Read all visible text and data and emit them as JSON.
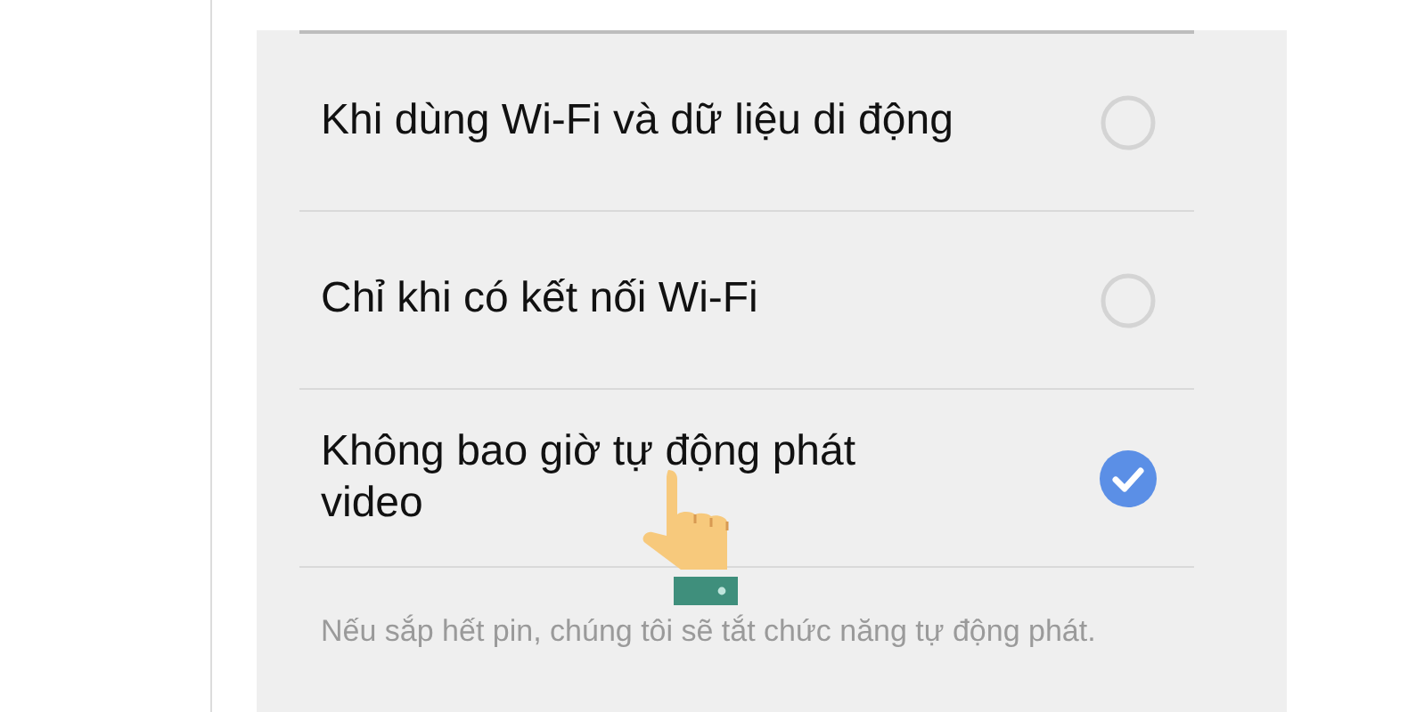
{
  "options": [
    {
      "label": "Khi dùng Wi-Fi và dữ liệu di động",
      "selected": false
    },
    {
      "label": "Chỉ khi có kết nối Wi-Fi",
      "selected": false
    },
    {
      "label": "Không bao giờ tự động phát video",
      "selected": true
    }
  ],
  "note": "Nếu sắp hết pin, chúng tôi sẽ tắt chức năng tự động phát."
}
